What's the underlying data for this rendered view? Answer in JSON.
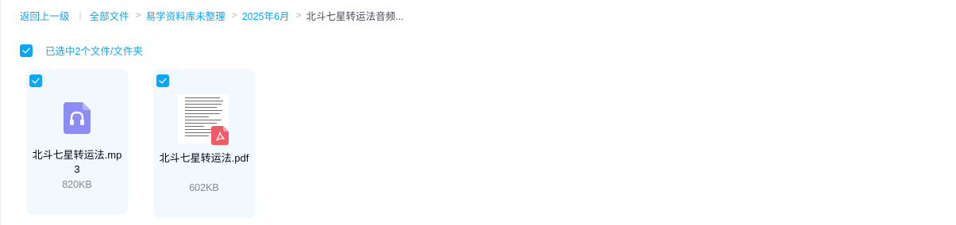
{
  "breadcrumb": {
    "back": "返回上一级",
    "divider": "|",
    "items": [
      "全部文件",
      "易学资料库未整理",
      "2025年6月"
    ],
    "current": "北斗七星转运法音频...",
    "separator": ">"
  },
  "selection": {
    "text": "已选中2个文件/文件夹",
    "checked": true
  },
  "files": [
    {
      "name": "北斗七星转运法.mp3",
      "size": "820KB",
      "type": "audio-file-icon",
      "checked": true
    },
    {
      "name": "北斗七星转运法.pdf",
      "size": "602KB",
      "type": "pdf-thumbnail",
      "checked": true
    }
  ],
  "colors": {
    "accent": "#06a7ff",
    "card_bg": "#f1f8fe",
    "audio_icon": "#8c8cf7",
    "pdf_badge": "#f25a67"
  }
}
